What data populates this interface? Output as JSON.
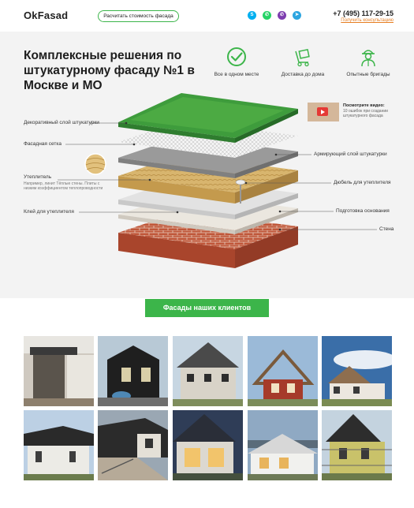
{
  "header": {
    "logo": "OkFasad",
    "calc_button": "Расчитать стоимость фасада",
    "phone": "+7 (495) 117-29-15",
    "callback": "Получить консультацию",
    "socials": [
      {
        "name": "skype-icon",
        "color": "#00aff0",
        "glyph": "S"
      },
      {
        "name": "whatsapp-icon",
        "color": "#25d366",
        "glyph": "✆"
      },
      {
        "name": "viber-icon",
        "color": "#7d3daf",
        "glyph": "✆"
      },
      {
        "name": "telegram-icon",
        "color": "#2ca5e0",
        "glyph": "➤"
      }
    ]
  },
  "hero": {
    "title": "Комплексные решения по штукатурному фасаду №1 в Москве и МО",
    "features": [
      {
        "label": "Все в одном месте",
        "icon": "check-circle-icon"
      },
      {
        "label": "Доставка до дома",
        "icon": "delivery-cart-icon"
      },
      {
        "label": "Опытные бригады",
        "icon": "worker-icon"
      }
    ]
  },
  "video": {
    "title": "Посмотрите видео:",
    "subtitle": "10 ошибок при создании штукатурного фасада"
  },
  "layers": {
    "left": [
      {
        "label": "Декоративный слой штукатурки"
      },
      {
        "label": "Фасадная сетка"
      },
      {
        "label": "Утеплитель",
        "sub": "Например, линит Тёплые стены. Плиты с низким коэффициентом теплопроводности"
      },
      {
        "label": "Клей для утеплителя"
      }
    ],
    "right": [
      {
        "label": "Армирующий слой штукатурки"
      },
      {
        "label": "Дюбель для утеплителя"
      },
      {
        "label": "Подготовка основания"
      },
      {
        "label": "Стена"
      }
    ]
  },
  "clients": {
    "button": "Фасады наших клиентов"
  },
  "colors": {
    "accent": "#3cb54a",
    "callback": "#e67e22"
  }
}
